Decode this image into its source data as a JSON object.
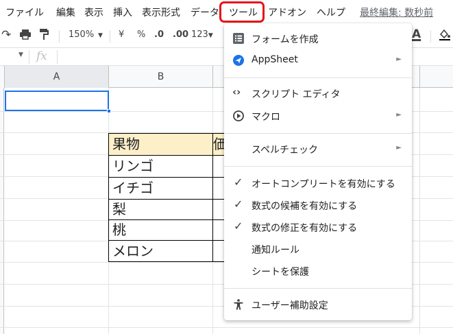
{
  "menubar": {
    "items": [
      "ファイル",
      "編集",
      "表示",
      "挿入",
      "表示形式",
      "データ",
      "ツール",
      "アドオン",
      "ヘルプ"
    ],
    "last_edit": "最終編集: 数秒前"
  },
  "toolbar": {
    "zoom": "150%",
    "currency": "¥",
    "percent": "%",
    "dec_decrease": ".0",
    "dec_increase": ".00",
    "format_more": "123"
  },
  "formula_bar": {
    "fx": "fx"
  },
  "columns": [
    "A",
    "B"
  ],
  "table": {
    "header": "果物",
    "header_col2": "価",
    "rows": [
      "リンゴ",
      "イチゴ",
      "梨",
      "桃",
      "メロン"
    ]
  },
  "tools_menu": {
    "items": [
      {
        "label": "フォームを作成",
        "icon": "form-icon"
      },
      {
        "label": "AppSheet",
        "icon": "appsheet-icon",
        "submenu": "►"
      },
      {
        "label": "スクリプト エディタ",
        "icon": "code-icon"
      },
      {
        "label": "マクロ",
        "icon": "macro-icon",
        "submenu": "►"
      },
      {
        "label": "スペルチェック",
        "submenu": "►"
      },
      {
        "label": "オートコンプリートを有効にする",
        "checked": "✓"
      },
      {
        "label": "数式の候補を有効にする",
        "checked": "✓"
      },
      {
        "label": "数式の修正を有効にする",
        "checked": "✓"
      },
      {
        "label": "通知ルール"
      },
      {
        "label": "シートを保護"
      },
      {
        "label": "ユーザー補助設定",
        "icon": "accessibility-icon"
      }
    ]
  },
  "colors": {
    "highlight_border": "#e8111a",
    "table_header_bg": "#fdefc8",
    "selection": "#1a73e8"
  }
}
